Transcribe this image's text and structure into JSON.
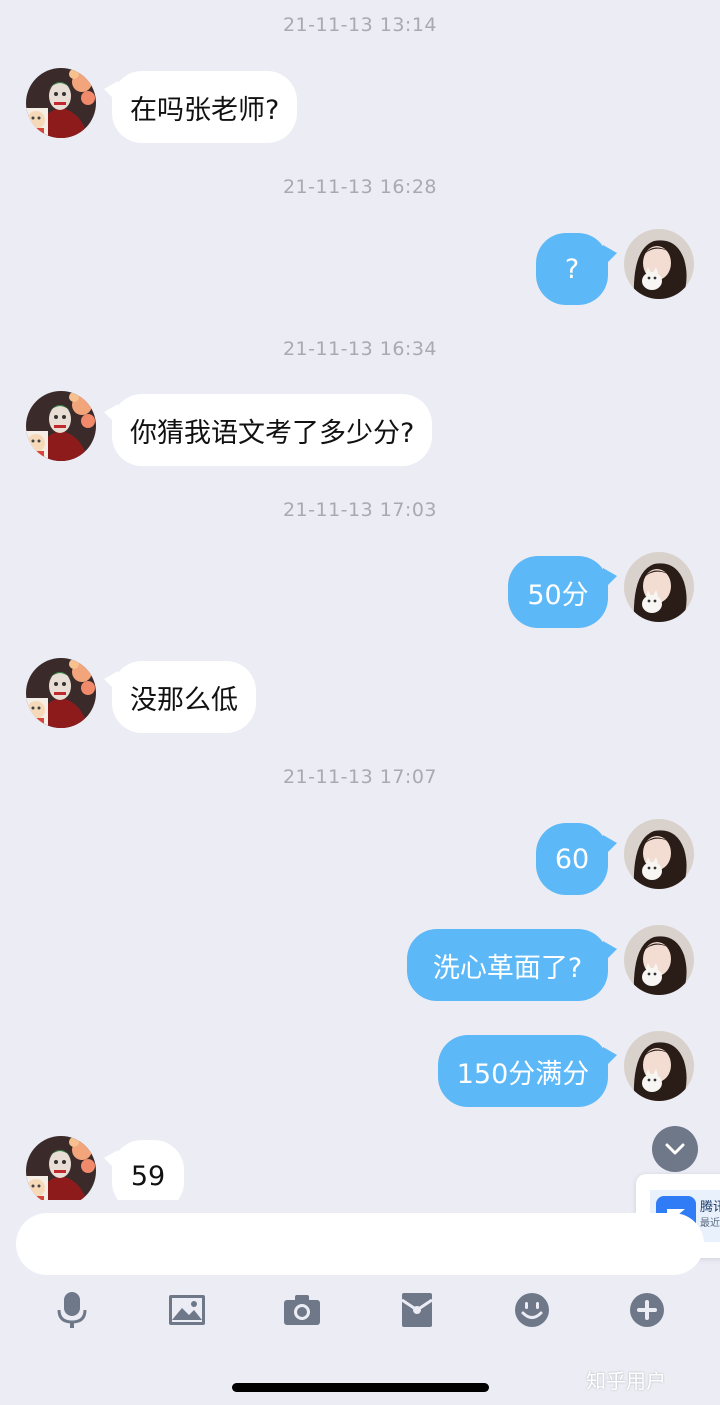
{
  "messages": {
    "ts1": "21-11-13 13:14",
    "m1": "在吗张老师?",
    "ts2": "21-11-13 16:28",
    "m2": "?",
    "ts3": "21-11-13 16:34",
    "m3": "你猜我语文考了多少分?",
    "ts4": "21-11-13 17:03",
    "m4": "50分",
    "m5": "没那么低",
    "ts5": "21-11-13 17:07",
    "m6": "60",
    "m7": "洗心革面了?",
    "m8": "150分满分",
    "m9": "59"
  },
  "floating_card": {
    "title": "腾讯",
    "subtitle": "最近"
  },
  "input": {
    "placeholder": ""
  },
  "toolbar": {
    "icons": [
      "microphone-icon",
      "image-icon",
      "camera-icon",
      "red-packet-icon",
      "emoji-icon",
      "plus-icon"
    ]
  },
  "watermark": "知乎用户",
  "colors": {
    "background": "#ececf5",
    "outgoing_bubble": "#5db8f7",
    "incoming_bubble": "#ffffff",
    "icon_gray": "#6e7889"
  }
}
